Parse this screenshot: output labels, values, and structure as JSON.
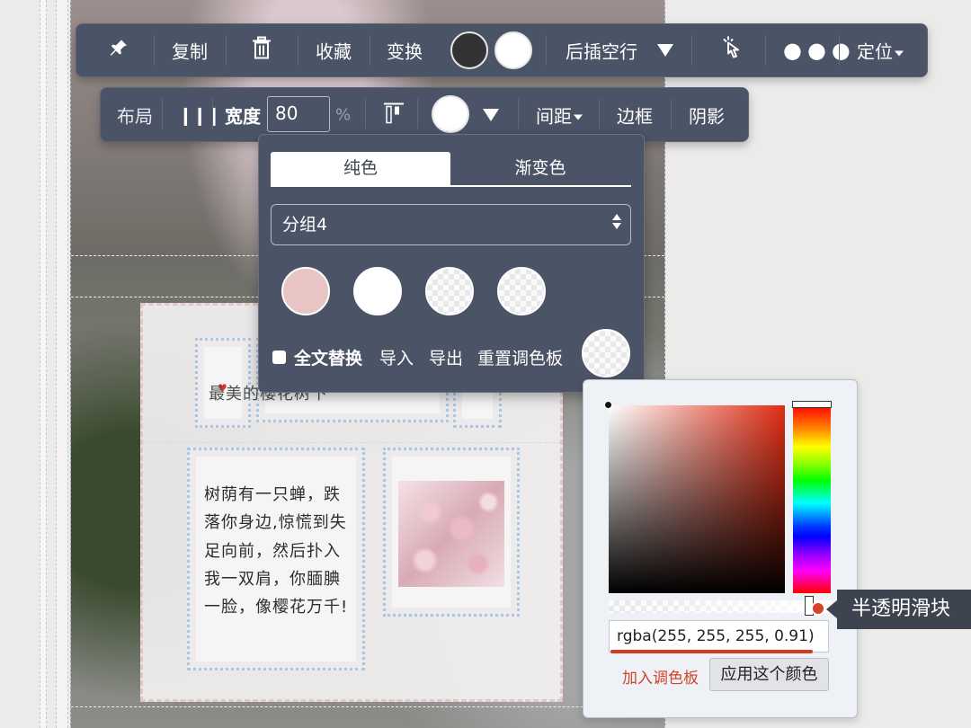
{
  "toolbar_main": {
    "pin_icon": "pin-icon",
    "copy_label": "复制",
    "delete_icon": "trash-icon",
    "favorite_label": "收藏",
    "transform_label": "变换",
    "color_dark": "#333333",
    "color_light": "#ffffff",
    "insert_after_label": "后插空行",
    "pointer_icon": "pointer-click-icon",
    "more_icon": "more-dots-icon",
    "position_label": "定位"
  },
  "toolbar_style": {
    "layout_label": "布局",
    "width_label": "宽度",
    "width_value": "80",
    "width_unit": "%",
    "spacing_label": "间距",
    "border_label": "边框",
    "shadow_label": "阴影",
    "bg_color": "#ffffff"
  },
  "palette": {
    "tab_solid": "纯色",
    "tab_gradient": "渐变色",
    "group_selected": "分组4",
    "swatches": [
      "#e8c4c4",
      "#ffffff",
      "rgba(255,255,255,0.5)",
      "rgba(255,255,255,0.5)"
    ],
    "replace_all_label": "全文替换",
    "replace_all_checked": false,
    "import_label": "导入",
    "export_label": "导出",
    "reset_label": "重置调色板"
  },
  "picker": {
    "hue_color": "#e12d14",
    "rgba_value": "rgba(255, 255, 255, 0.91)",
    "alpha": 0.91,
    "add_to_palette_label": "加入调色板",
    "apply_label": "应用这个颜色"
  },
  "annotation": {
    "label": "半透明滑块"
  },
  "article": {
    "title": "最美的樱花树下",
    "poem": "树荫有一只蝉，跌落你身边,惊慌到失足向前，然后扑入我一双肩，你腼腆一脸，像樱花万千!"
  }
}
